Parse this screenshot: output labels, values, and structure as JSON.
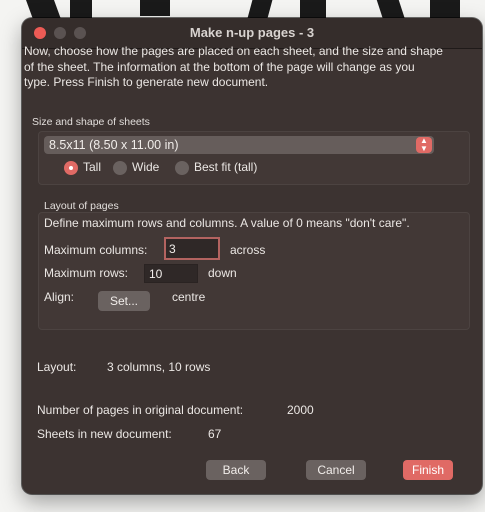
{
  "window": {
    "title": "Make n-up pages - 3"
  },
  "intro": "Now, choose how the pages are placed on each sheet, and the size and shape of the sheet. The information at the bottom of the page will change as you type. Press Finish to generate new document.",
  "sheet": {
    "group_label": "Size and shape of sheets",
    "size_value": "8.5x11 (8.50 x 11.00 in)",
    "orientation_options": [
      "Tall",
      "Wide",
      "Best fit (tall)"
    ],
    "orientation_selected": "Tall"
  },
  "layout_group": {
    "label": "Layout of pages",
    "help": "Define maximum rows and columns. A value of 0 means \"don't care\".",
    "columns_label": "Maximum columns:",
    "columns_value": "3",
    "columns_suffix": "across",
    "rows_label": "Maximum rows:",
    "rows_value": "10",
    "rows_suffix": "down",
    "align_label": "Align:",
    "align_button": "Set...",
    "align_value": "centre"
  },
  "summary": {
    "layout_label": "Layout:",
    "layout_value": "3 columns, 10 rows",
    "pages_label": "Number of pages in original document:",
    "pages_value": "2000",
    "sheets_label": "Sheets in new document:",
    "sheets_value": "67"
  },
  "buttons": {
    "back": "Back",
    "cancel": "Cancel",
    "finish": "Finish"
  },
  "colors": {
    "accent": "#e06a65",
    "window_bg": "#3c3331"
  }
}
